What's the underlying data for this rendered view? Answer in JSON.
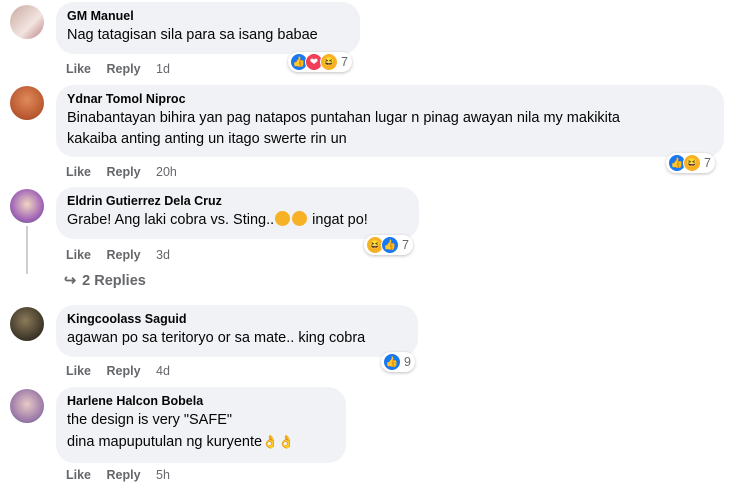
{
  "colors": {
    "like_blue": "#1877f2",
    "haha_yellow": "#f7b125",
    "love_red": "#f33e58",
    "bubble_bg": "#f0f2f5",
    "meta_gray": "#65676b"
  },
  "actions": {
    "like": "Like",
    "reply": "Reply"
  },
  "comments": [
    {
      "author": "GM Manuel",
      "lines": [
        "Nag tatagisan sila para sa isang babae"
      ],
      "time": "1d",
      "reaction_count": "7",
      "reaction_icons": [
        "like-icon",
        "love-icon",
        "haha-icon"
      ]
    },
    {
      "author": "Ydnar Tomol Niproc",
      "lines": [
        "Binabantayan bihira yan pag natapos puntahan lugar n pinag awayan nila my makikita",
        "kakaiba anting anting un itago swerte rin un"
      ],
      "time": "20h",
      "reaction_count": "7",
      "reaction_icons": [
        "like-icon",
        "haha-icon"
      ]
    },
    {
      "author": "Eldrin Gutierrez Dela Cruz",
      "lines": [
        "Grabe! Ang laki cobra vs. Sting..",
        " ingat po!"
      ],
      "time": "3d",
      "reaction_count": "7",
      "reaction_icons": [
        "haha-icon",
        "like-icon"
      ],
      "replies_label": "2 Replies"
    },
    {
      "author": "Kingcoolass Saguid",
      "lines": [
        "agawan po sa teritoryo or sa mate.. king cobra"
      ],
      "time": "4d",
      "reaction_count": "9",
      "reaction_icons": [
        "like-icon"
      ]
    },
    {
      "author": "Harlene Halcon Bobela",
      "lines": [
        "the design is very \"SAFE\"",
        "dina mapuputulan ng kuryente"
      ],
      "time": "5h",
      "reaction_icons": []
    }
  ]
}
